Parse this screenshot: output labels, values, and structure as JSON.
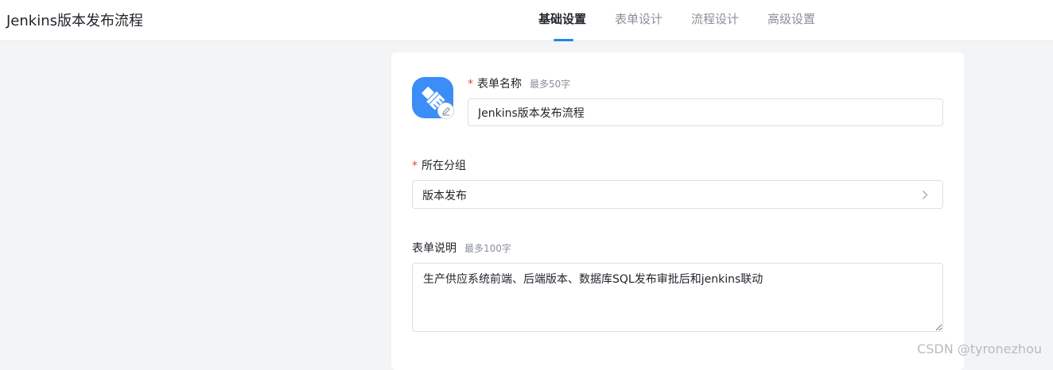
{
  "header": {
    "app_title": "Jenkins版本发布流程",
    "tabs": [
      {
        "label": "基础设置",
        "active": true
      },
      {
        "label": "表单设计",
        "active": false
      },
      {
        "label": "流程设计",
        "active": false
      },
      {
        "label": "高级设置",
        "active": false
      }
    ]
  },
  "form": {
    "icon": {
      "name": "brush-icon",
      "color": "#3a8ef6",
      "badge": "edit-icon"
    },
    "name_field": {
      "required_mark": "*",
      "label": "表单名称",
      "hint": "最多50字",
      "value": "Jenkins版本发布流程"
    },
    "group_field": {
      "required_mark": "*",
      "label": "所在分组",
      "value": "版本发布"
    },
    "description_field": {
      "label": "表单说明",
      "hint": "最多100字",
      "value": "生产供应系统前端、后端版本、数据库SQL发布审批后和jenkins联动"
    }
  },
  "watermark": "CSDN @tyronezhou",
  "colors": {
    "accent": "#1e88e5",
    "icon_bg": "#3a8ef6",
    "required": "#e54545",
    "page_bg": "#f3f4f6"
  }
}
